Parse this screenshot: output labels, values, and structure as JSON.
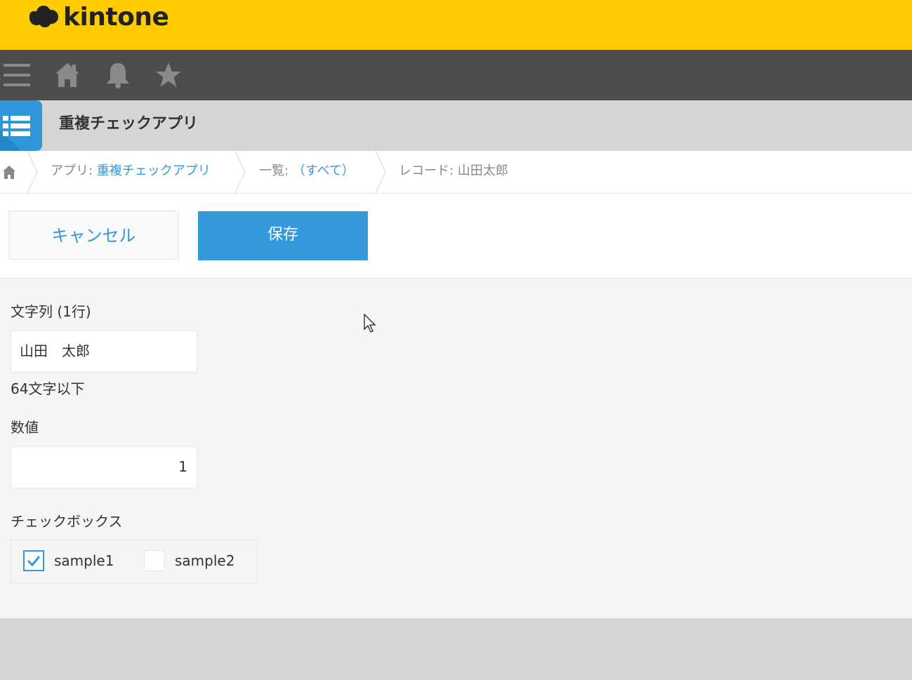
{
  "header": {
    "brand": "kintone",
    "brand_color": "#fecb00"
  },
  "nav": {
    "icons": [
      "menu-icon",
      "home-icon",
      "bell-icon",
      "star-icon"
    ]
  },
  "app": {
    "title": "重複チェックアプリ",
    "icon": "list-icon"
  },
  "breadcrumb": {
    "app_prefix": "アプリ: ",
    "app_name": "重複チェックアプリ",
    "list_prefix": "一覧: ",
    "list_name": "（すべて）",
    "record": "レコード: 山田太郎"
  },
  "toolbar": {
    "cancel_label": "キャンセル",
    "save_label": "保存"
  },
  "form": {
    "text_field": {
      "label": "文字列 (1行)",
      "value": "山田　太郎",
      "hint": "64文字以下"
    },
    "number_field": {
      "label": "数値",
      "value": "1"
    },
    "checkbox_field": {
      "label": "チェックボックス",
      "options": [
        {
          "label": "sample1",
          "checked": true
        },
        {
          "label": "sample2",
          "checked": false
        }
      ]
    }
  },
  "colors": {
    "accent": "#3498db",
    "navbar": "#4d4d4d"
  }
}
